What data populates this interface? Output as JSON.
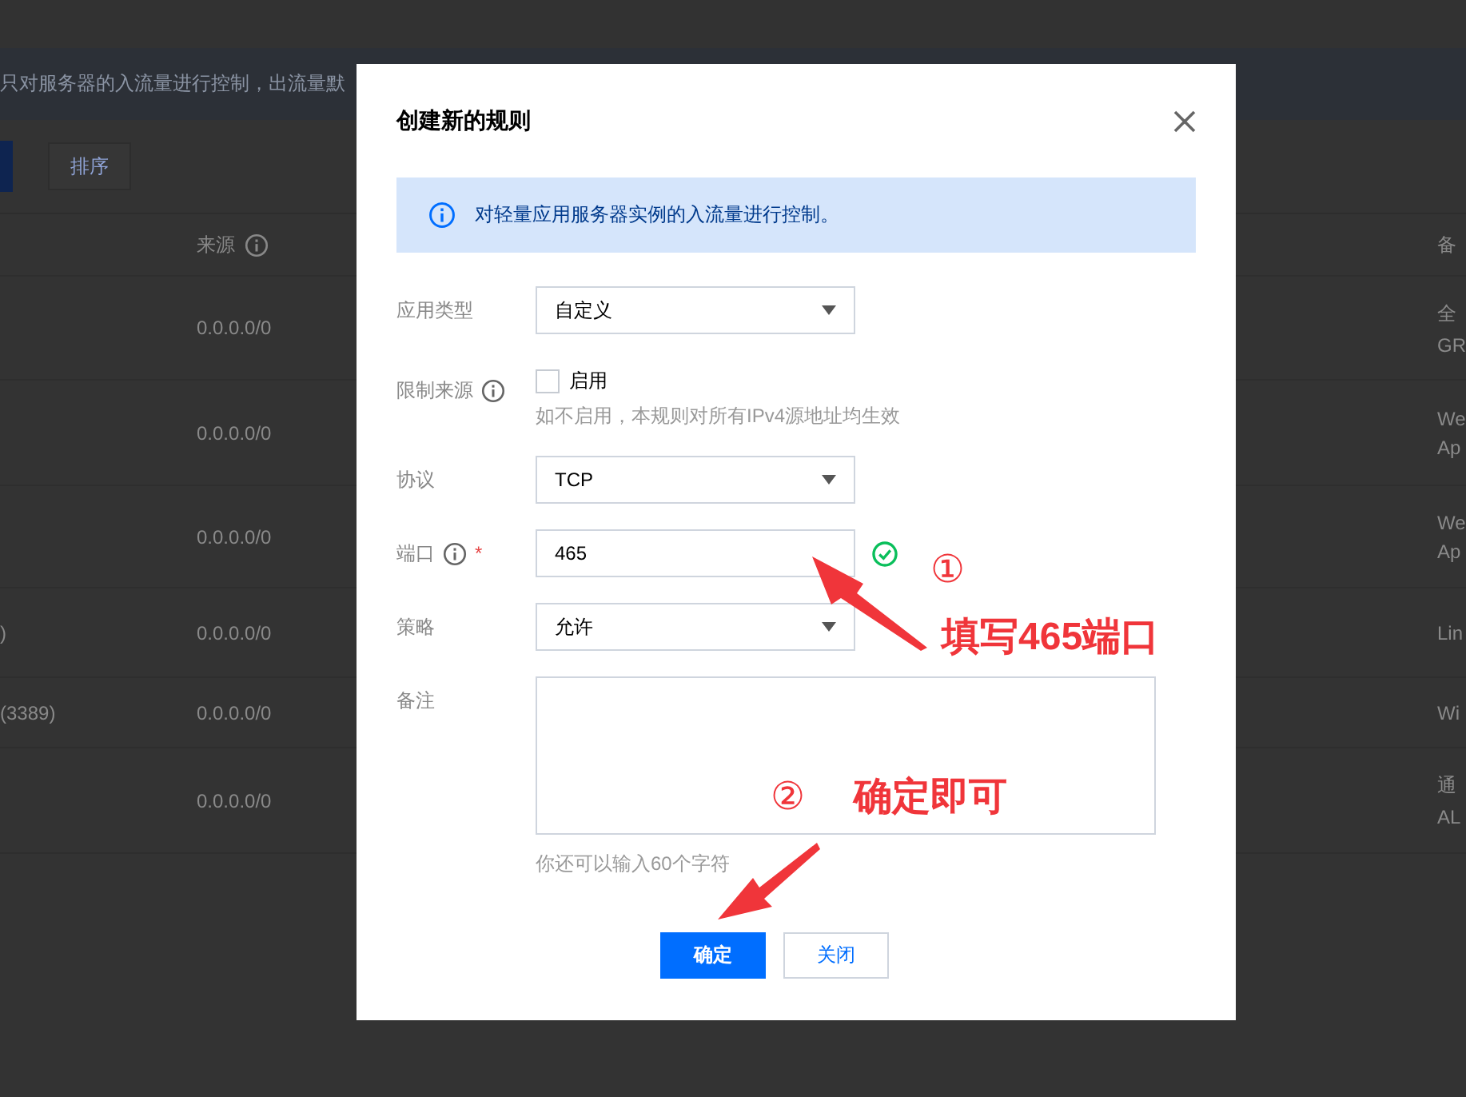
{
  "background": {
    "notice": "只对服务器的入流量进行控制，出流量默",
    "toolbar": {
      "sort_button": "排序"
    },
    "table": {
      "columns": [
        {
          "label": "来源",
          "info": true
        },
        {
          "label": "备"
        }
      ],
      "rows": [
        {
          "source": "0.0.0.0/0",
          "remark": [
            "全",
            "GR"
          ]
        },
        {
          "source": "0.0.0.0/0",
          "remark": [
            "We",
            "Ap"
          ]
        },
        {
          "source": "0.0.0.0/0",
          "remark": [
            "We",
            "Ap"
          ]
        },
        {
          "column_1": ")",
          "source": "0.0.0.0/0",
          "remark": [
            "Lin"
          ]
        },
        {
          "column_1": "(3389)",
          "source": "0.0.0.0/0",
          "remark": [
            "Wi"
          ]
        },
        {
          "source": "0.0.0.0/0",
          "remark": [
            "通",
            "AL"
          ]
        }
      ]
    }
  },
  "dialog": {
    "title": "创建新的规则",
    "info": "对轻量应用服务器实例的入流量进行控制。",
    "fields": [
      {
        "kind": "select",
        "label": "应用类型",
        "value": "自定义"
      },
      {
        "kind": "checkbox",
        "label": "限制来源",
        "info": true,
        "checked": false,
        "option": "启用",
        "hint": "如不启用，本规则对所有IPv4源地址均生效"
      },
      {
        "kind": "select",
        "label": "协议",
        "value": "TCP"
      },
      {
        "kind": "input",
        "label": "端口",
        "info": true,
        "required_mark": "*",
        "value": "465",
        "valid": true
      },
      {
        "kind": "select",
        "label": "策略",
        "value": "允许"
      },
      {
        "kind": "textarea",
        "label": "备注",
        "hint": "你还可以输入60个字符"
      }
    ],
    "buttons": [
      {
        "label": "确定",
        "kind": "primary"
      },
      {
        "label": "关闭",
        "kind": "default"
      }
    ]
  },
  "annotations": [
    {
      "number": "①",
      "text": "填写465端口"
    },
    {
      "number": "②",
      "text": "确定即可"
    }
  ]
}
